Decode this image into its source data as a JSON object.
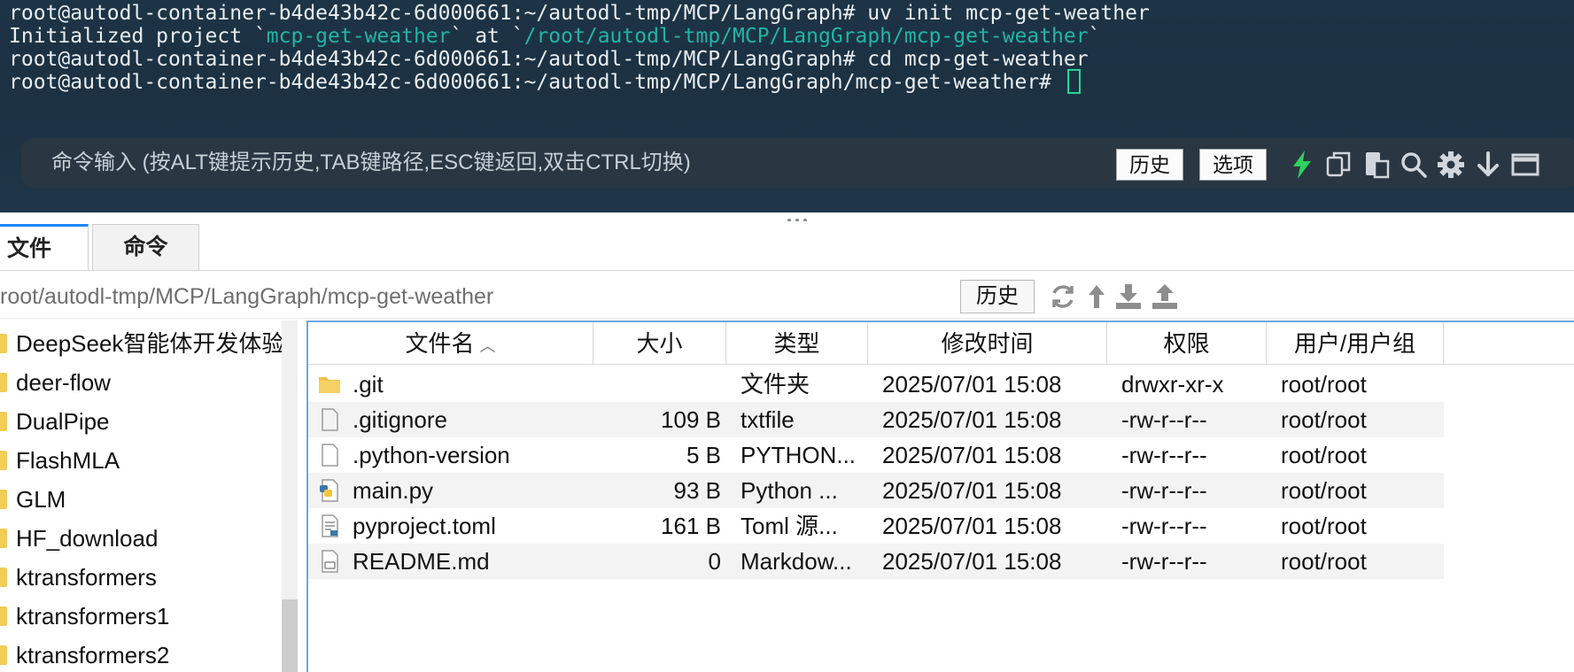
{
  "terminal": {
    "lines": [
      {
        "text": "root@autodl-container-b4de43b42c-6d000661:~/autodl-tmp/MCP/LangGraph# uv init mcp-get-weather"
      },
      {
        "pre": "Initialized project `",
        "hl1": "mcp-get-weather",
        "mid": "` at `",
        "hl2": "/root/autodl-tmp/MCP/LangGraph/mcp-get-weather",
        "post": "`"
      },
      {
        "text": "root@autodl-container-b4de43b42c-6d000661:~/autodl-tmp/MCP/LangGraph# cd mcp-get-weather"
      },
      {
        "text": "root@autodl-container-b4de43b42c-6d000661:~/autodl-tmp/MCP/LangGraph/mcp-get-weather# "
      }
    ],
    "accent_color": "#22b4a5",
    "cursor_color": "#29d39a"
  },
  "command_bar": {
    "placeholder": "命令输入 (按ALT键提示历史,TAB键路径,ESC键返回,双击CTRL切换)",
    "history_label": "历史",
    "options_label": "选项",
    "icons": [
      "lightning-icon",
      "copy-icon",
      "paste-icon",
      "search-icon",
      "gear-icon",
      "download-arrow-icon",
      "maximize-icon"
    ]
  },
  "file_manager": {
    "tabs": [
      {
        "label": "文件",
        "active": true
      },
      {
        "label": "命令",
        "active": false
      }
    ],
    "path": "root/autodl-tmp/MCP/LangGraph/mcp-get-weather",
    "history_label": "历史",
    "path_icons": [
      "refresh-icon",
      "up-icon",
      "download-icon",
      "upload-icon"
    ],
    "tree": [
      "DeepSeek智能体开发体验",
      "deer-flow",
      "DualPipe",
      "FlashMLA",
      "GLM",
      "HF_download",
      "ktransformers",
      "ktransformers1",
      "ktransformers2"
    ],
    "columns": {
      "name": "文件名",
      "size": "大小",
      "type": "类型",
      "modified": "修改时间",
      "permissions": "权限",
      "owner": "用户/用户组"
    },
    "files": [
      {
        "name": ".git",
        "size": "",
        "type": "文件夹",
        "modified": "2025/07/01 15:08",
        "permissions": "drwxr-xr-x",
        "owner": "root/root",
        "icon": "folder-icon"
      },
      {
        "name": ".gitignore",
        "size": "109 B",
        "type": "txtfile",
        "modified": "2025/07/01 15:08",
        "permissions": "-rw-r--r--",
        "owner": "root/root",
        "icon": "file-icon"
      },
      {
        "name": ".python-version",
        "size": "5 B",
        "type": "PYTHON...",
        "modified": "2025/07/01 15:08",
        "permissions": "-rw-r--r--",
        "owner": "root/root",
        "icon": "file-icon"
      },
      {
        "name": "main.py",
        "size": "93 B",
        "type": "Python ...",
        "modified": "2025/07/01 15:08",
        "permissions": "-rw-r--r--",
        "owner": "root/root",
        "icon": "python-file-icon"
      },
      {
        "name": "pyproject.toml",
        "size": "161 B",
        "type": "Toml 源...",
        "modified": "2025/07/01 15:08",
        "permissions": "-rw-r--r--",
        "owner": "root/root",
        "icon": "toml-file-icon"
      },
      {
        "name": "README.md",
        "size": "0",
        "type": "Markdow...",
        "modified": "2025/07/01 15:08",
        "permissions": "-rw-r--r--",
        "owner": "root/root",
        "icon": "markdown-file-icon"
      }
    ]
  }
}
